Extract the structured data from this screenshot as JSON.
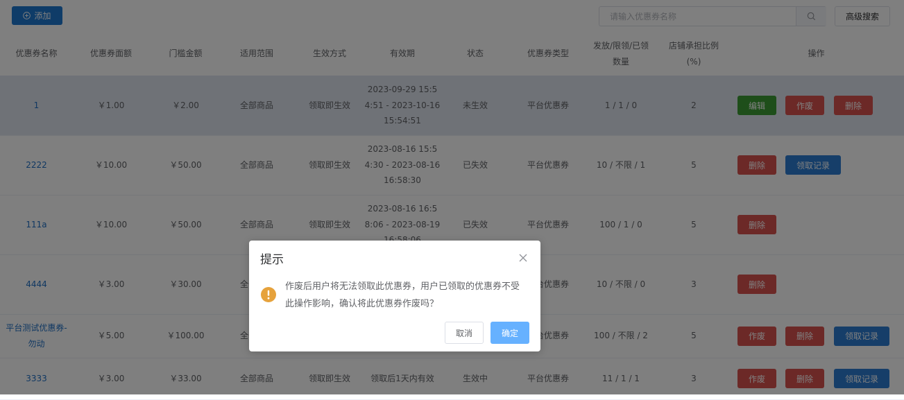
{
  "toolbar": {
    "add_label": "添加",
    "search_placeholder": "请输入优惠券名称",
    "advanced_search_label": "高级搜索"
  },
  "table": {
    "headers": [
      "优惠券名称",
      "优惠券面额",
      "门槛金额",
      "适用范围",
      "生效方式",
      "有效期",
      "状态",
      "优惠券类型",
      "发放/限领/已领数量",
      "店铺承担比例(%)",
      "操作"
    ],
    "rows": [
      {
        "name": "1",
        "amount": "￥1.00",
        "threshold": "￥2.00",
        "scope": "全部商品",
        "effect": "领取即生效",
        "validity": "2023-09-29 15:54:51 - 2023-10-16 15:54:51",
        "status": "未生效",
        "type": "平台优惠券",
        "qty": "1 / 1 / 0",
        "ratio": "2",
        "ops": [
          {
            "label": "编辑",
            "color": "green"
          },
          {
            "label": "作废",
            "color": "red"
          },
          {
            "label": "删除",
            "color": "red"
          }
        ]
      },
      {
        "name": "2222",
        "amount": "￥10.00",
        "threshold": "￥50.00",
        "scope": "全部商品",
        "effect": "领取即生效",
        "validity": "2023-08-16 15:54:30 - 2023-08-16 16:58:30",
        "status": "已失效",
        "type": "平台优惠券",
        "qty": "10 / 不限 / 1",
        "ratio": "5",
        "ops": [
          {
            "label": "删除",
            "color": "red"
          },
          {
            "label": "领取记录",
            "color": "blue"
          }
        ]
      },
      {
        "name": "111a",
        "amount": "￥10.00",
        "threshold": "￥50.00",
        "scope": "全部商品",
        "effect": "领取即生效",
        "validity": "2023-08-16 16:58:06 - 2023-08-19 16:58:06",
        "status": "已失效",
        "type": "平台优惠券",
        "qty": "100 / 1 / 0",
        "ratio": "5",
        "ops": [
          {
            "label": "删除",
            "color": "red"
          }
        ]
      },
      {
        "name": "4444",
        "amount": "￥3.00",
        "threshold": "￥30.00",
        "scope": "全部商品",
        "effect": "",
        "validity": "",
        "status": "",
        "type": "平台优惠券",
        "qty": "10 / 不限 / 0",
        "ratio": "3",
        "ops": [
          {
            "label": "删除",
            "color": "red"
          }
        ]
      },
      {
        "name": "平台测试优惠券-勿动",
        "amount": "￥5.00",
        "threshold": "￥100.00",
        "scope": "全部商品",
        "effect": "",
        "validity": "",
        "status": "",
        "type": "平台优惠券",
        "qty": "100 / 不限 / 2",
        "ratio": "5",
        "ops": [
          {
            "label": "作废",
            "color": "red"
          },
          {
            "label": "删除",
            "color": "red"
          },
          {
            "label": "领取记录",
            "color": "blue"
          }
        ]
      },
      {
        "name": "3333",
        "amount": "￥3.00",
        "threshold": "￥33.00",
        "scope": "全部商品",
        "effect": "领取即生效",
        "validity": "领取后1天内有效",
        "status": "生效中",
        "type": "平台优惠券",
        "qty": "11 / 1 / 1",
        "ratio": "3",
        "ops": [
          {
            "label": "作废",
            "color": "red"
          },
          {
            "label": "删除",
            "color": "red"
          },
          {
            "label": "领取记录",
            "color": "blue"
          }
        ]
      }
    ]
  },
  "dialog": {
    "title": "提示",
    "message": "作废后用户将无法领取此优惠券，用户已领取的优惠券不受此操作影响，确认将此优惠券作废吗？",
    "cancel_label": "取消",
    "confirm_label": "确定"
  },
  "colors": {
    "primary": "#1f78d1",
    "edit": "#3d9d35",
    "danger": "#d9534f",
    "record": "#2d7dd2",
    "warning": "#e6a23c",
    "confirm": "#66b1ff",
    "highlight_row": "#dfe4ee"
  },
  "icons": {
    "add": "plus-circle-icon",
    "search": "search-icon",
    "close": "close-icon",
    "warning": "warning-icon"
  }
}
